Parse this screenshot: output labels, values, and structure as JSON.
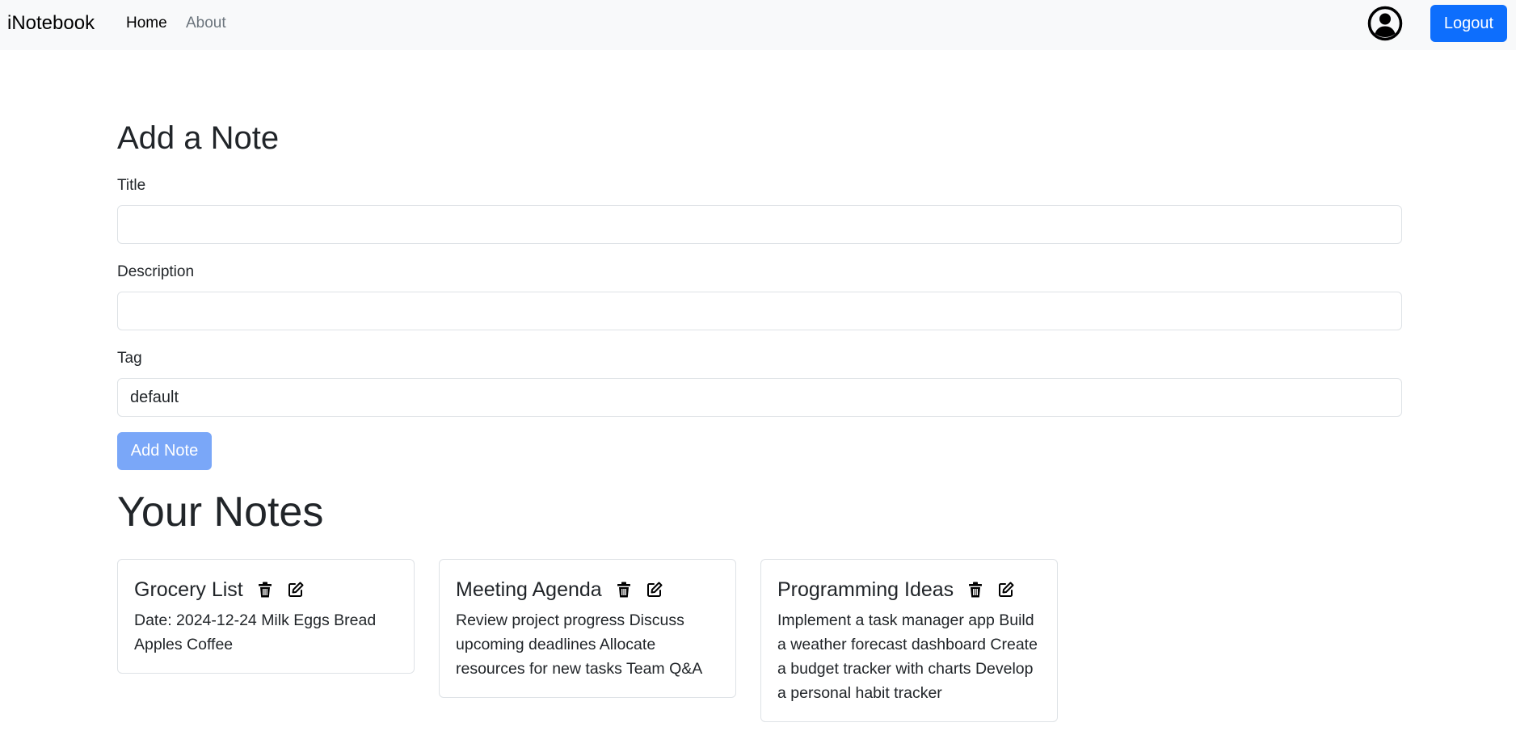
{
  "navbar": {
    "brand": "iNotebook",
    "links": [
      {
        "label": "Home"
      },
      {
        "label": "About"
      }
    ],
    "logout_label": "Logout",
    "user_icon": "user-circle-icon"
  },
  "form": {
    "heading": "Add a Note",
    "title_label": "Title",
    "title_value": "",
    "description_label": "Description",
    "description_value": "",
    "tag_label": "Tag",
    "tag_value": "default",
    "submit_label": "Add Note"
  },
  "notes": {
    "heading": "Your Notes",
    "items": [
      {
        "title": "Grocery List",
        "description": "Date: 2024-12-24 Milk Eggs Bread Apples Coffee"
      },
      {
        "title": "Meeting Agenda",
        "description": "Review project progress Discuss upcoming deadlines Allocate resources for new tasks Team Q&A"
      },
      {
        "title": "Programming Ideas",
        "description": "Implement a task manager app Build a weather forecast dashboard Create a budget tracker with charts Develop a personal habit tracker"
      }
    ]
  },
  "colors": {
    "primary": "#0d6efd",
    "primary_disabled": "#7aa7f8",
    "navbar_bg": "#f8f9fa",
    "muted": "#6c757d"
  }
}
